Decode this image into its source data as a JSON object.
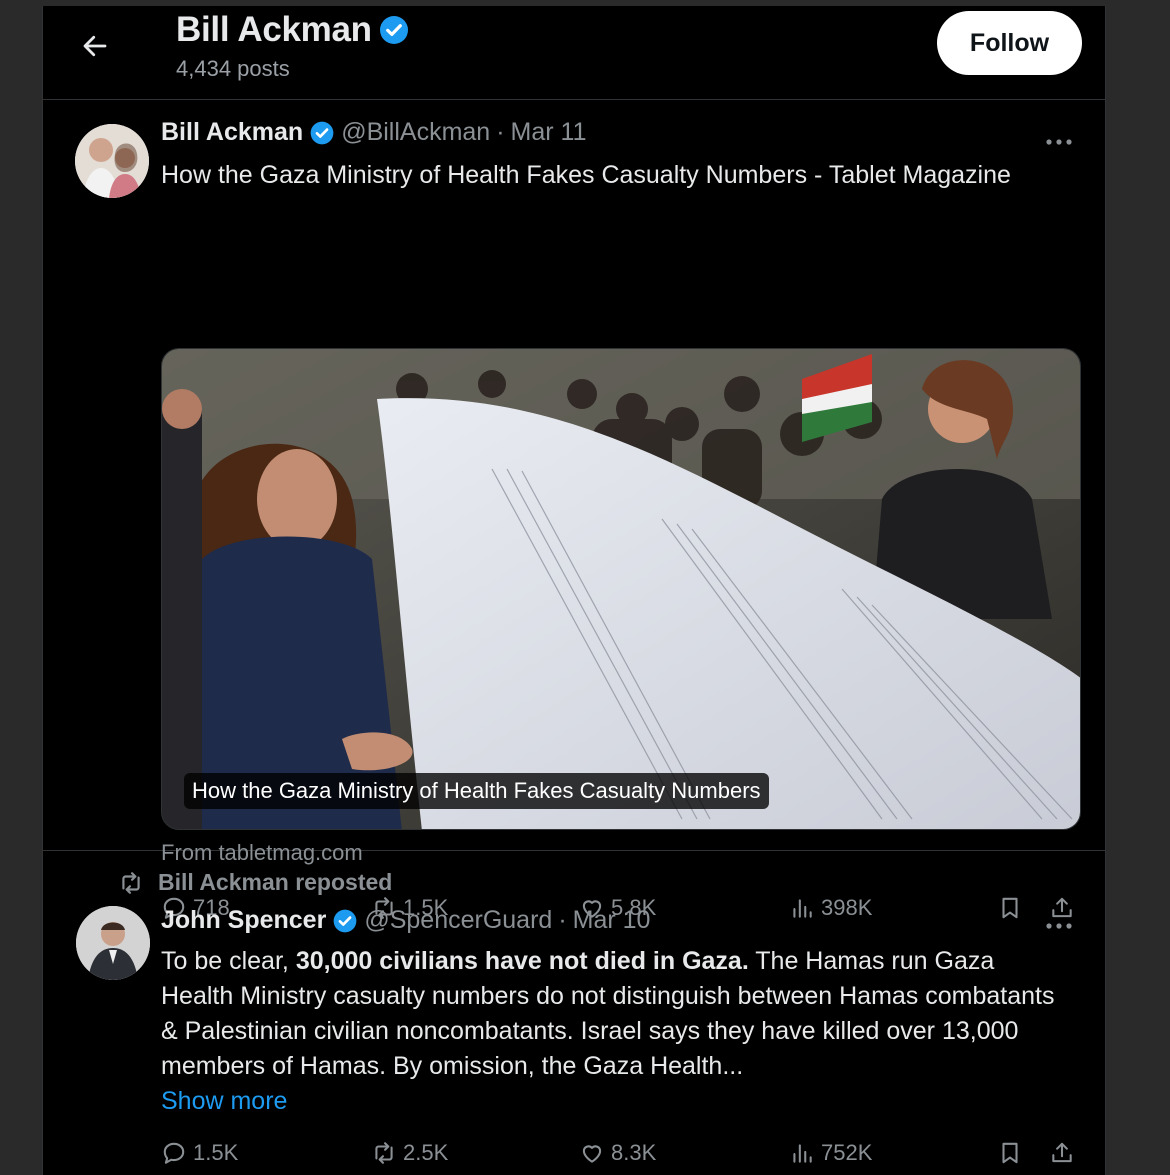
{
  "header": {
    "name": "Bill Ackman",
    "posts": "4,434 posts",
    "follow_label": "Follow"
  },
  "tweet1": {
    "name": "Bill Ackman",
    "handle": "@BillAckman",
    "dot": "·",
    "date": "Mar 11",
    "text": "How the Gaza Ministry of Health Fakes Casualty Numbers - Tablet Magazine",
    "card_caption": "How the Gaza Ministry of Health Fakes Casualty Numbers",
    "from": "From tabletmag.com",
    "replies": "718",
    "reposts": "1.5K",
    "likes": "5.8K",
    "views": "398K"
  },
  "tweet2": {
    "repost_label": "Bill Ackman reposted",
    "name": "John Spencer",
    "handle": "@SpencerGuard",
    "dot": "·",
    "date": "Mar 10",
    "text_pre": "To be clear, ",
    "text_bold": "30,000 civilians have not died in Gaza.",
    "text_post": " The Hamas run Gaza Health Ministry casualty numbers do not distinguish between Hamas combatants & Palestinian civilian noncombatants. Israel says they have killed over 13,000 members of Hamas. By omission, the Gaza Health...",
    "show_more": "Show more",
    "replies": "1.5K",
    "reposts": "2.5K",
    "likes": "8.3K",
    "views": "752K"
  },
  "colors": {
    "background": "#000000",
    "text": "#e7e9ea",
    "secondary": "#8b9095",
    "verified": "#1d9bf0",
    "link": "#1d9bf0"
  },
  "icons": [
    "back-arrow-icon",
    "verified-badge-icon",
    "more-icon",
    "reply-icon",
    "repost-icon",
    "like-icon",
    "views-icon",
    "bookmark-icon",
    "share-icon"
  ]
}
